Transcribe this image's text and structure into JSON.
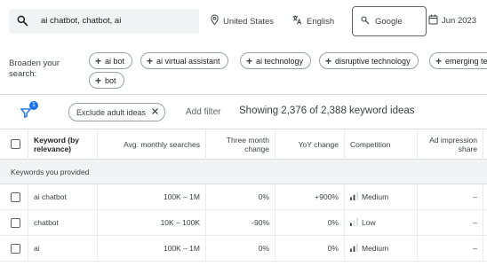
{
  "search": {
    "query": "ai chatbot, chatbot, ai"
  },
  "location": {
    "label": "United States"
  },
  "language": {
    "label": "English"
  },
  "engine": {
    "label": "Google"
  },
  "date_range": {
    "label": "Jun 2023"
  },
  "broaden": {
    "label": "Broaden your search:",
    "chips": [
      "ai bot",
      "ai virtual assistant",
      "ai technology",
      "disruptive technology",
      "emerging te",
      "bot"
    ]
  },
  "filters": {
    "badge_count": "1",
    "exclude_chip": "Exclude adult ideas",
    "add_filter": "Add filter",
    "showing": "Showing 2,376 of 2,388 keyword ideas"
  },
  "table": {
    "headers": {
      "keyword": "Keyword (by relevance)",
      "avg": "Avg. monthly searches",
      "three_month": "Three month change",
      "yoy": "YoY change",
      "competition": "Competition",
      "ad_share": "Ad impression share"
    },
    "group_label": "Keywords you provided",
    "rows": [
      {
        "keyword": "ai chatbot",
        "avg": "100K – 1M",
        "three_month": "0%",
        "yoy": "+900%",
        "competition": "Medium",
        "ad_share": "–"
      },
      {
        "keyword": "chatbot",
        "avg": "10K – 100K",
        "three_month": "-90%",
        "yoy": "0%",
        "competition": "Low",
        "ad_share": "–"
      },
      {
        "keyword": "ai",
        "avg": "100K – 1M",
        "three_month": "0%",
        "yoy": "0%",
        "competition": "Medium",
        "ad_share": "–"
      }
    ]
  },
  "colors": {
    "accent": "#1a73e8",
    "chip_border": "#9aa0a6",
    "group_bg": "#f1f3f4"
  }
}
